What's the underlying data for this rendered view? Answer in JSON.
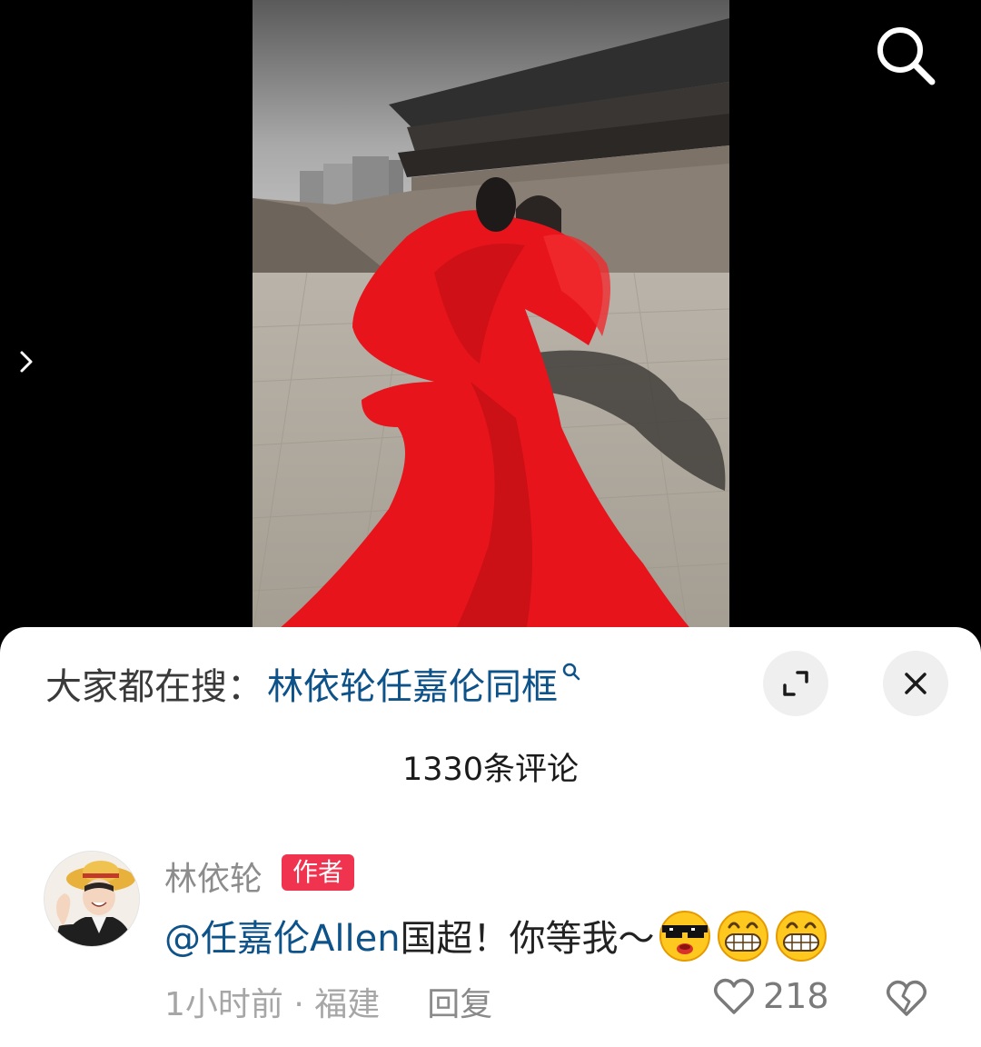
{
  "video": {
    "content_icon": "video-thumbnail",
    "search_icon": "search-icon",
    "expand_icon": "chevron-right-icon"
  },
  "comment_sheet": {
    "hot_search_prefix": "大家都在搜：",
    "hot_search_keyword": "林依轮任嘉伦同框",
    "hot_search_icon": "magnifier-icon",
    "fullscreen_icon": "fullscreen-icon",
    "close_icon": "close-icon",
    "comment_count": "1330条评论",
    "comments": [
      {
        "author": "林依轮",
        "badge": "作者",
        "mention": "@任嘉伦Allen",
        "text": " 国超！你等我～",
        "emojis": [
          "cool-sunglasses-emoji",
          "grinning-emoji",
          "grinning-emoji"
        ],
        "time_location": "1小时前 · 福建",
        "reply_label": "回复",
        "like_count": "218",
        "like_icon": "heart-outline-icon",
        "dislike_icon": "broken-heart-icon"
      }
    ]
  },
  "colors": {
    "link_blue": "#0d5289",
    "badge_red": "#f0334f",
    "sheet_bg": "#ffffff",
    "dress_red": "#e8141c"
  }
}
